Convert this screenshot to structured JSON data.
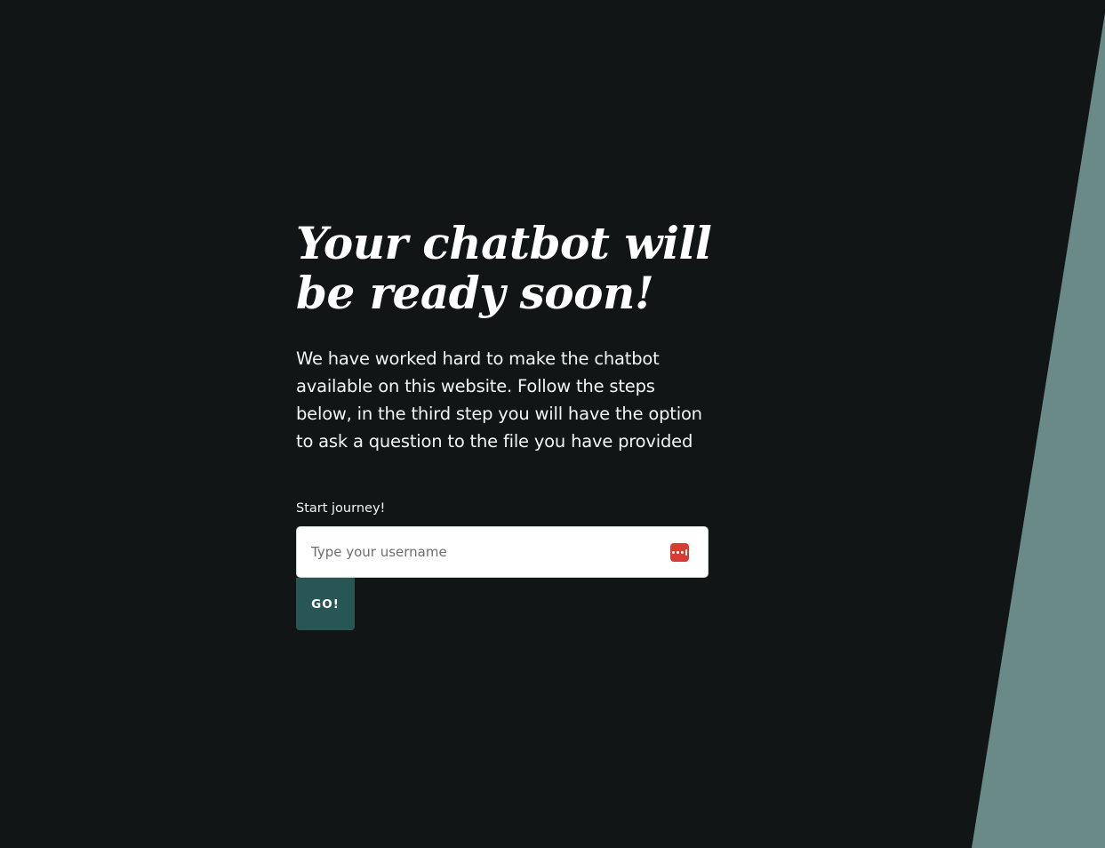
{
  "colors": {
    "background": "#111516",
    "accent_stripe": "#6a8a87",
    "button": "#275655",
    "icon_red": "#d93a32"
  },
  "hero": {
    "title": "Your chatbot will be ready soon!",
    "description": "We have worked hard to make the chatbot available on this website. Follow the steps below, in the third step you will have the option to ask a question to the file you have provided"
  },
  "form": {
    "label": "Start journey!",
    "username_placeholder": "Type your username",
    "username_value": "",
    "field_icon": "password-manager-icon",
    "submit_label": "GO!"
  }
}
